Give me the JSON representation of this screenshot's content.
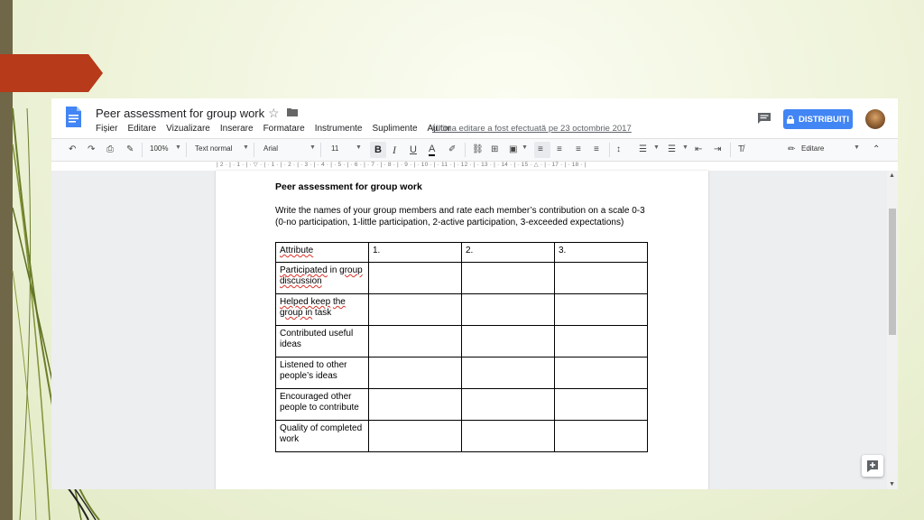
{
  "doc": {
    "title": "Peer assessment for group work",
    "last_edit": "Ultima editare a fost efectuată pe 23 octombrie 2017",
    "share_label": "DISTRIBUIȚI"
  },
  "menus": [
    "Fișier",
    "Editare",
    "Vizualizare",
    "Inserare",
    "Formatare",
    "Instrumente",
    "Suplimente",
    "Ajutor"
  ],
  "toolbar": {
    "zoom": "100%",
    "style": "Text normal",
    "font": "Arial",
    "size": "11",
    "mode": "Editare"
  },
  "ruler": "| 2 · | · 1 · | · ▽ · | · 1 · | · 2 · | · 3 · | · 4 · | · 5 · | · 6 · | · 7 · | · 8 · | · 9 · | · 10 · | · 11 · | · 12 · | · 13 · | · 14 · | · 15 · △ · | · 17 · | · 18 · |",
  "content": {
    "heading": "Peer assessment for group work",
    "instructions": "Write the names of your group members and rate each member’s contribution on a scale 0-3 (0-no participation, 1-little participation, 2-active participation, 3-exceeded expectations)",
    "table": {
      "headers": [
        "Attribute",
        "1.",
        "2.",
        "3."
      ],
      "rows": [
        {
          "a": "Participated",
          "b": " in ",
          "c": "group",
          "d": " discussion"
        },
        {
          "a": "Helped keep",
          "b": " ",
          "c": "the",
          "d": " ",
          "e": "group in",
          "f": " task"
        },
        "Contributed useful ideas",
        "Listened to other people’s ideas",
        "Encouraged other people to contribute",
        "Quality of completed work"
      ]
    }
  },
  "colors": {
    "accent": "#4285f4",
    "slide_arrow": "#b73a1a",
    "slide_bar": "#6f6747"
  }
}
